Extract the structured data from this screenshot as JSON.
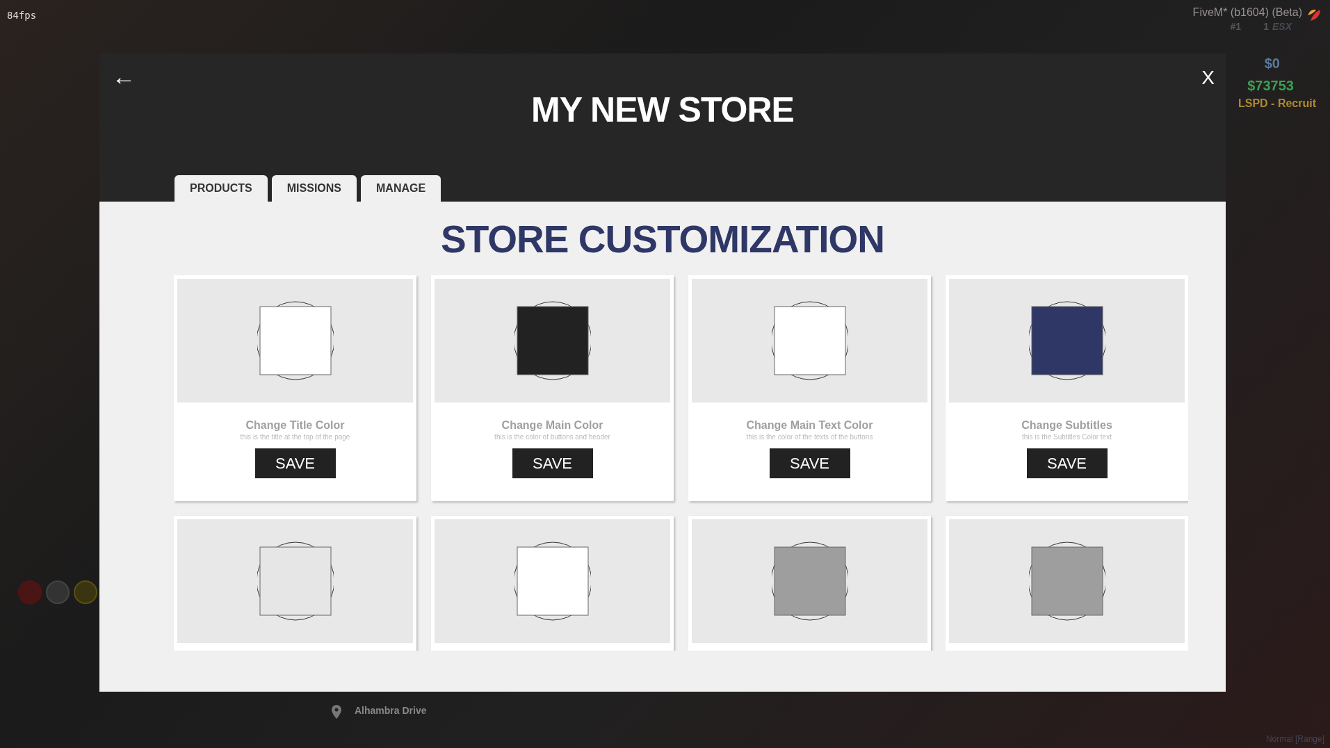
{
  "hud": {
    "fps": "84fps",
    "client": "FiveM* (b1604) (Beta)",
    "rank": "#1",
    "players": "1",
    "server": "ESX",
    "cash": "$0",
    "bank": "$73753",
    "job": "LSPD - Recruit",
    "street": "Alhambra Drive",
    "voice": "Normal [Range]"
  },
  "window": {
    "title": "MY NEW STORE",
    "back": "←",
    "close": "X"
  },
  "tabs": [
    {
      "label": "PRODUCTS",
      "selected": false
    },
    {
      "label": "MISSIONS",
      "selected": false
    },
    {
      "label": "MANAGE",
      "selected": false
    }
  ],
  "heading": "STORE CUSTOMIZATION",
  "cards": [
    {
      "title": "Change Title Color",
      "subtitle": "this is the title at the top of the page",
      "button": "SAVE",
      "color": "#ffffff"
    },
    {
      "title": "Change Main Color",
      "subtitle": "this is the color of buttons and header",
      "button": "SAVE",
      "color": "#222222"
    },
    {
      "title": "Change Main Text Color",
      "subtitle": "this is the color of the texts of the buttons",
      "button": "SAVE",
      "color": "#ffffff"
    },
    {
      "title": "Change Subtitles",
      "subtitle": "this is the Subtitles Color text",
      "button": "SAVE",
      "color": "#2e3765"
    },
    {
      "color": "#e6e6e6"
    },
    {
      "color": "#ffffff"
    },
    {
      "color": "#9e9e9e"
    },
    {
      "color": "#9e9e9e"
    }
  ]
}
